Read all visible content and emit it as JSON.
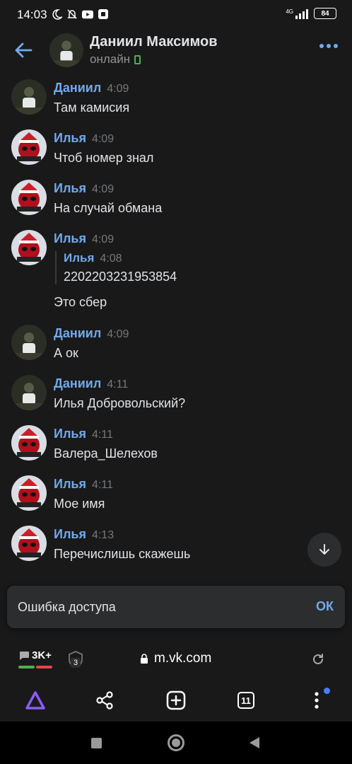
{
  "status_bar": {
    "time": "14:03",
    "network": "4G",
    "battery": "84",
    "icons": [
      "moon-icon",
      "notifications-off-icon",
      "youtube-icon",
      "app-icon",
      "signal-icon",
      "battery-icon"
    ]
  },
  "header": {
    "name": "Даниил Максимов",
    "status": "онлайн",
    "icons": [
      "back-arrow-icon",
      "more-icon",
      "mobile-online-icon"
    ]
  },
  "messages": [
    {
      "author": "Даниил",
      "time": "4:09",
      "text": "Там камисия",
      "avatar": "daniil"
    },
    {
      "author": "Илья",
      "time": "4:09",
      "text": "Чтоб номер знал",
      "avatar": "ilya"
    },
    {
      "author": "Илья",
      "time": "4:09",
      "text": "На случай обмана",
      "avatar": "ilya"
    },
    {
      "author": "Илья",
      "time": "4:09",
      "text": "Это сбер",
      "avatar": "ilya",
      "reply": {
        "author": "Илья",
        "time": "4:08",
        "text": "2202203231953854"
      }
    },
    {
      "author": "Даниил",
      "time": "4:09",
      "text": "А ок",
      "avatar": "daniil"
    },
    {
      "author": "Даниил",
      "time": "4:11",
      "text": "Илья Добровольский?",
      "avatar": "daniil"
    },
    {
      "author": "Илья",
      "time": "4:11",
      "text": "Валера_Шелехов",
      "avatar": "ilya"
    },
    {
      "author": "Илья",
      "time": "4:11",
      "text": "Мое имя",
      "avatar": "ilya"
    },
    {
      "author": "Илья",
      "time": "4:13",
      "text": "Перечислишь скажешь",
      "avatar": "ilya"
    }
  ],
  "toast": {
    "text": "Ошибка доступа",
    "button": "ОК"
  },
  "browser": {
    "tabs_count_label": "3K+",
    "tracker_count": "3",
    "url": "m.vk.com",
    "open_tabs": "11",
    "icons": [
      "alice-icon",
      "share-icon",
      "new-tab-icon",
      "tabs-icon",
      "menu-icon",
      "lock-icon",
      "reload-icon",
      "shield-icon",
      "chat-bubble-icon"
    ]
  },
  "colors": {
    "accent": "#71aaeb",
    "background": "#19191a",
    "text": "#e1e3e6",
    "secondary": "#76787a",
    "online": "#4bb34b",
    "alice": "#8a5cf6"
  }
}
